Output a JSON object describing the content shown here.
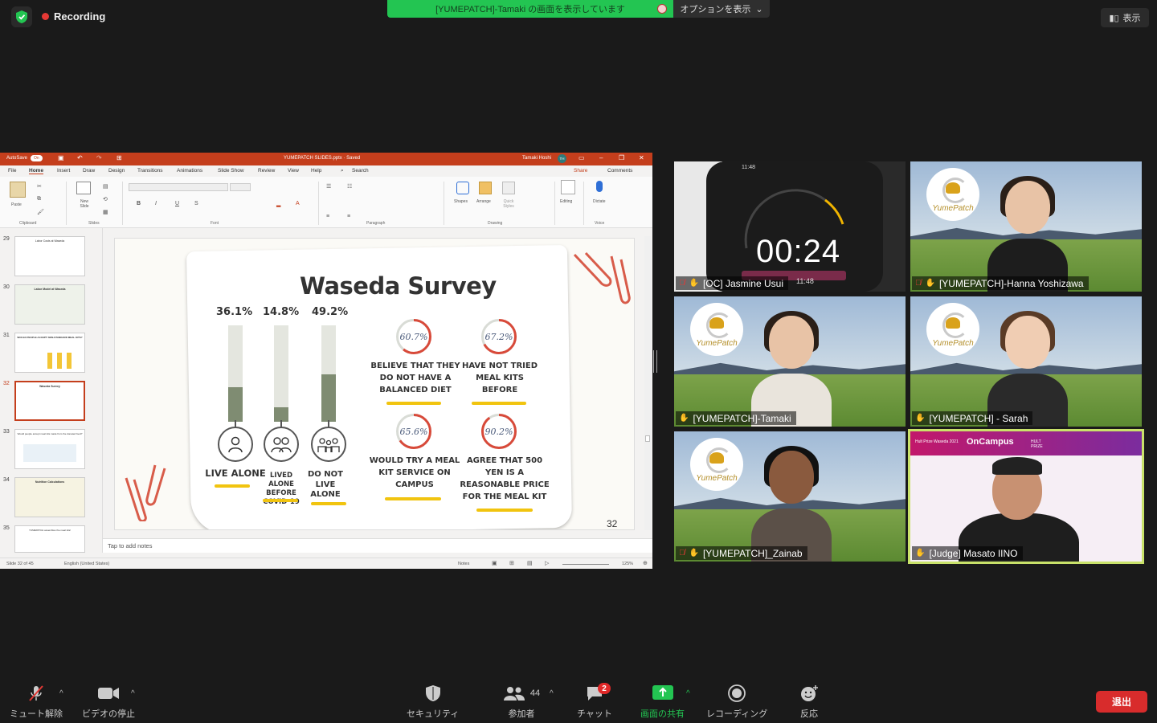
{
  "topbar": {
    "recording_label": "Recording",
    "share_banner": "[YUMEPATCH]-Tamaki の画面を表示しています",
    "options_label": "オプションを表示",
    "view_label": "表示"
  },
  "ppt": {
    "autosave_label": "AutoSave",
    "autosave_state": "On",
    "file_title": "YUMEPATCH SLIDES.pptx · Saved",
    "user_name": "Tamaki Hoshi",
    "user_initials": "TH",
    "menu": [
      "File",
      "Home",
      "Insert",
      "Draw",
      "Design",
      "Transitions",
      "Animations",
      "Slide Show",
      "Review",
      "View",
      "Help"
    ],
    "search_label": "Search",
    "share_label": "Share",
    "comments_label": "Comments",
    "ribbon_groups": [
      "Clipboard",
      "Slides",
      "Font",
      "Paragraph",
      "Drawing",
      "Voice"
    ],
    "ribbon_buttons": {
      "paste": "Paste",
      "new_slide": "New Slide",
      "shapes": "Shapes",
      "arrange": "Arrange",
      "quick_styles": "Quick Styles",
      "editing": "Editing",
      "dictate": "Dictate"
    },
    "thumbnails": [
      {
        "num": "29",
        "title": "Labor Costs at Waseda"
      },
      {
        "num": "30",
        "title": "Labor Model at Waseda"
      },
      {
        "num": "31",
        "title": "WOULD PEOPLE ACCEPT NON-STANDARD MEAL KITS?"
      },
      {
        "num": "32",
        "title": "Waseda Survey"
      },
      {
        "num": "33",
        "title": "Would people accept meal kits made from the donated food?"
      },
      {
        "num": "34",
        "title": "Nutrition Calculations"
      },
      {
        "num": "35",
        "title": "YUMEPATCH assembles the meal kits!"
      }
    ],
    "notes_placeholder": "Tap to add notes",
    "status": {
      "slide_of": "Slide 32 of 45",
      "language": "English (United States)",
      "notes_btn": "Notes",
      "zoom": "125%"
    }
  },
  "slide": {
    "title": "Waseda Survey",
    "page_number": "32",
    "bars": [
      {
        "pct": "36.1%",
        "value": 36.1,
        "label": "LIVE ALONE"
      },
      {
        "pct": "14.8%",
        "value": 14.8,
        "label": "LIVED ALONE BEFORE COVID-19"
      },
      {
        "pct": "49.2%",
        "value": 49.2,
        "label": "DO NOT LIVE ALONE"
      }
    ],
    "rings": [
      {
        "pct": "60.7%",
        "value": 60.7,
        "label": "BELIEVE THAT THEY DO NOT HAVE A BALANCED DIET"
      },
      {
        "pct": "67.2%",
        "value": 67.2,
        "label": "HAVE NOT TRIED MEAL KITS BEFORE"
      },
      {
        "pct": "65.6%",
        "value": 65.6,
        "label": "WOULD TRY A MEAL KIT SERVICE ON CAMPUS"
      },
      {
        "pct": "90.2%",
        "value": 90.2,
        "label": "AGREE THAT 500 YEN IS A REASONABLE PRICE FOR THE MEAL KIT"
      }
    ]
  },
  "participants": [
    {
      "name": "[OC] Jasmine Usui",
      "muted": true,
      "timer": "00:24",
      "clock": "11:48",
      "clock2": "11:48"
    },
    {
      "name": "[YUMEPATCH]-Hanna Yoshizawa",
      "muted": true
    },
    {
      "name": "[YUMEPATCH]-Tamaki",
      "muted": false
    },
    {
      "name": "[YUMEPATCH] - Sarah",
      "muted": false
    },
    {
      "name": "[YUMEPATCH]_Zainab",
      "muted": true
    },
    {
      "name": "[Judge] Masato IINO",
      "muted": false,
      "banner_left": "Hult Prize Waseda 2021",
      "banner_brand": "OnCampus",
      "banner_hult": "HULT PRIZE"
    }
  ],
  "toolbar": {
    "unmute": "ミュート解除",
    "stop_video": "ビデオの停止",
    "security": "セキュリティ",
    "participants": "参加者",
    "participants_count": "44",
    "chat": "チャット",
    "chat_badge": "2",
    "share_screen": "画面の共有",
    "recording": "レコーディング",
    "reactions": "反応",
    "leave": "退出"
  },
  "colors": {
    "share_green": "#23c552",
    "ppt_red": "#c43e1c",
    "bar_fill": "#7f8c72",
    "underline_yellow": "#f1c40f",
    "ring_red": "#d84a3a",
    "leave_red": "#d82c2c",
    "active_speaker": "#c9e26a"
  }
}
